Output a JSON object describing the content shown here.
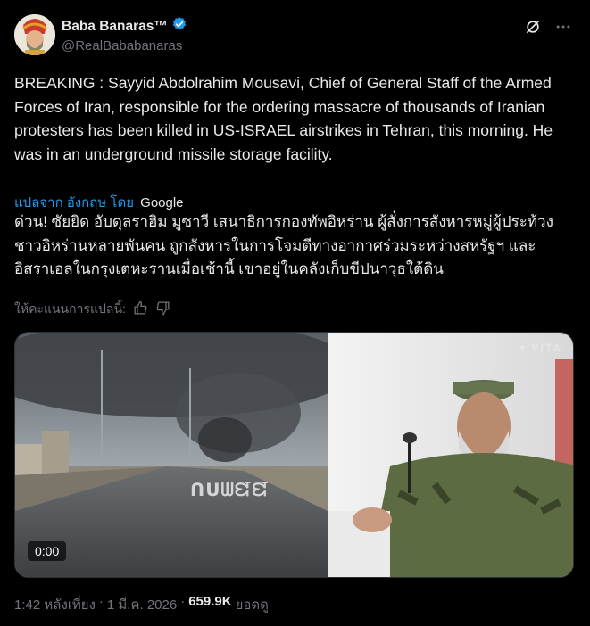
{
  "author": {
    "display_name": "Baba Banaras™",
    "handle": "@RealBababanaras",
    "verified": true,
    "verified_color": "#1d9bf0"
  },
  "tweet": {
    "text": "BREAKING : Sayyid Abdolrahim Mousavi, Chief of General Staff of the Armed Forces of Iran, responsible for the ordering massacre of thousands of Iranian protesters has been killed in US-ISRAEL airstrikes in Tehran, this morning. He was in an underground missile storage facility.",
    "translate_label": "แปลจาก อังกฤษ โดย",
    "translate_provider": "Google",
    "translated_text": "ด่วน! ซัยยิด อับดุลราฮิม มูซาวี เสนาธิการกองทัพอิหร่าน ผู้สั่งการสังหารหมู่ผู้ประท้วงชาวอิหร่านหลายพันคน ถูกสังหารในการโจมตีทางอากาศร่วมระหว่างสหรัฐฯ และอิสราเอลในกรุงเตหะรานเมื่อเช้านี้ เขาอยู่ในคลังเก็บขีปนาวุธใต้ดิน",
    "rate_translation_label": "ให้คะแนนการแปลนี้:"
  },
  "media": {
    "video_time": "0:00",
    "left_watermark": "ᑎᑌᗯᘿᘿ",
    "right_watermark": "VITA"
  },
  "meta": {
    "time": "1:42 หลังเที่ยง",
    "date": "1 มี.ค. 2026",
    "views_count": "659.9K",
    "views_label": "ยอดดู"
  },
  "icons": [
    "grok-icon",
    "more-icon",
    "thumbs-up-icon",
    "thumbs-down-icon",
    "verified-badge-icon"
  ]
}
